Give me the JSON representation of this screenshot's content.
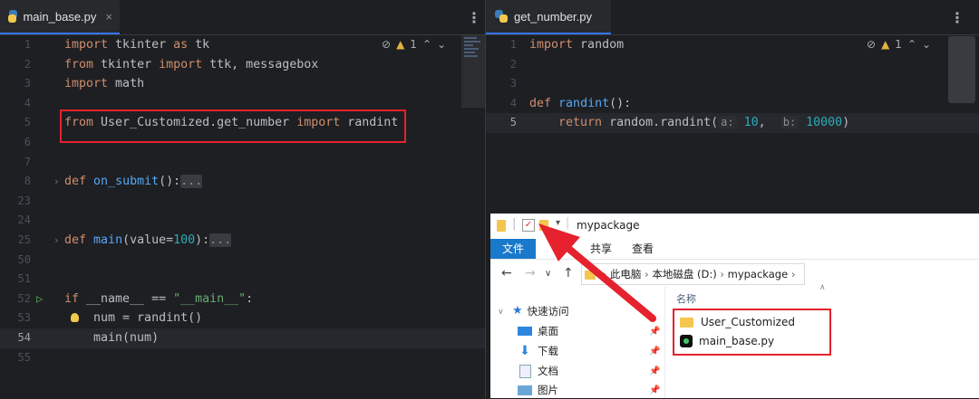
{
  "left_editor": {
    "tab_label": "main_base.py",
    "close_glyph": "×",
    "menu_glyph": "⋮",
    "warning_count": "1",
    "lines": [
      {
        "n": "1",
        "tokens": [
          [
            "kw",
            "import"
          ],
          [
            "t",
            " tkinter "
          ],
          [
            "kw",
            "as"
          ],
          [
            "t",
            " tk"
          ]
        ]
      },
      {
        "n": "2",
        "tokens": [
          [
            "kw",
            "from"
          ],
          [
            "t",
            " tkinter "
          ],
          [
            "kw",
            "import"
          ],
          [
            "t",
            " ttk, messagebox"
          ]
        ]
      },
      {
        "n": "3",
        "tokens": [
          [
            "kw",
            "import"
          ],
          [
            "t",
            " math"
          ]
        ]
      },
      {
        "n": "4",
        "tokens": []
      },
      {
        "n": "5",
        "tokens": [
          [
            "kw",
            "from"
          ],
          [
            "t",
            " User_Customized.get_number "
          ],
          [
            "kw",
            "import"
          ],
          [
            "t",
            " randint"
          ]
        ]
      },
      {
        "n": "6",
        "tokens": []
      },
      {
        "n": "7",
        "tokens": []
      },
      {
        "n": "8",
        "tokens": [
          [
            "kw",
            "def"
          ],
          [
            "t",
            " "
          ],
          [
            "fn",
            "on_submit"
          ],
          [
            "t",
            "():"
          ],
          [
            "fold",
            "..."
          ]
        ]
      },
      {
        "n": "23",
        "tokens": []
      },
      {
        "n": "24",
        "tokens": []
      },
      {
        "n": "25",
        "tokens": [
          [
            "kw",
            "def"
          ],
          [
            "t",
            " "
          ],
          [
            "fn",
            "main"
          ],
          [
            "t",
            "(value="
          ],
          [
            "num",
            "100"
          ],
          [
            "t",
            "):"
          ],
          [
            "fold",
            "..."
          ]
        ]
      },
      {
        "n": "50",
        "tokens": []
      },
      {
        "n": "51",
        "tokens": []
      },
      {
        "n": "52",
        "tokens": [
          [
            "kw",
            "if"
          ],
          [
            "t",
            " __name__ == "
          ],
          [
            "str",
            "\"__main__\""
          ],
          [
            "t",
            ":"
          ]
        ]
      },
      {
        "n": "53",
        "tokens": [
          [
            "t",
            "    num = randint()"
          ]
        ]
      },
      {
        "n": "54",
        "tokens": [
          [
            "t",
            "    main(num)"
          ]
        ]
      },
      {
        "n": "55",
        "tokens": []
      }
    ]
  },
  "right_editor": {
    "tab_label": "get_number.py",
    "menu_glyph": "⋮",
    "warning_count": "1",
    "lines": [
      {
        "n": "1",
        "tokens": [
          [
            "kw",
            "import"
          ],
          [
            "t",
            " random"
          ]
        ]
      },
      {
        "n": "2",
        "tokens": []
      },
      {
        "n": "3",
        "tokens": []
      },
      {
        "n": "4",
        "tokens": [
          [
            "kw",
            "def"
          ],
          [
            "t",
            " "
          ],
          [
            "fn",
            "randint"
          ],
          [
            "t",
            "():"
          ]
        ]
      },
      {
        "n": "5",
        "tokens": [
          [
            "t",
            "    "
          ],
          [
            "kw",
            "return"
          ],
          [
            "t",
            " random.randint("
          ],
          [
            "hint",
            "a:"
          ],
          [
            "t",
            " "
          ],
          [
            "num",
            "10"
          ],
          [
            "t",
            ",  "
          ],
          [
            "hint",
            "b:"
          ],
          [
            "t",
            " "
          ],
          [
            "num",
            "10000"
          ],
          [
            "t",
            ")"
          ]
        ]
      }
    ]
  },
  "explorer": {
    "title": "mypackage",
    "ribbon_tabs": [
      "文件",
      "共享",
      "查看"
    ],
    "breadcrumb": [
      "此电脑",
      "本地磁盘 (D:)",
      "mypackage"
    ],
    "column_header": "名称",
    "nav_items": [
      {
        "label": "快速访问",
        "icon": "star-icon"
      },
      {
        "label": "桌面",
        "icon": "desktop-icon"
      },
      {
        "label": "下载",
        "icon": "download-icon"
      },
      {
        "label": "文档",
        "icon": "document-icon"
      },
      {
        "label": "图片",
        "icon": "pictures-icon"
      }
    ],
    "files": [
      {
        "name": "User_Customized",
        "icon": "folder-icon"
      },
      {
        "name": "main_base.py",
        "icon": "pycharm-file-icon"
      }
    ]
  },
  "colors": {
    "keyword": "#cf8e6d",
    "function": "#56a8f5",
    "number": "#2aacb8",
    "string": "#6aab73",
    "annotation_red": "#e5222d"
  }
}
